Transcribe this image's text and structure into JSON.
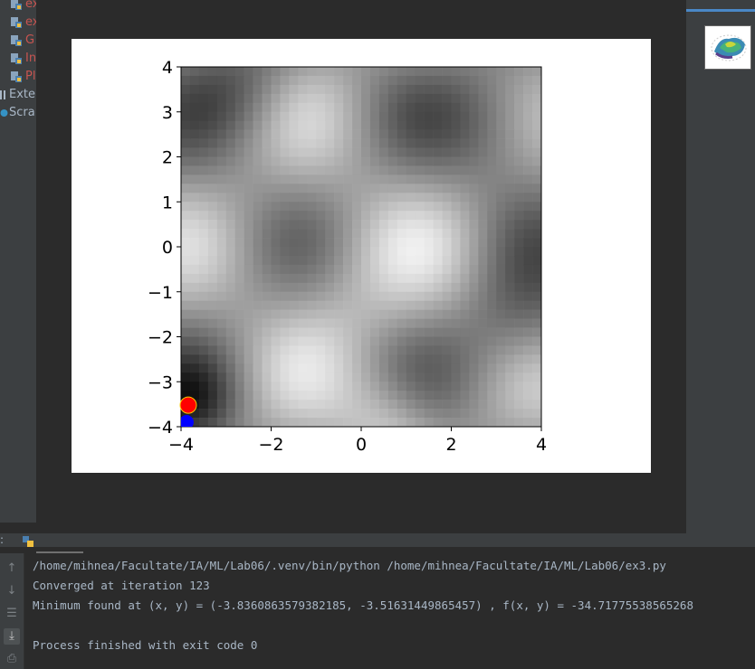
{
  "project_tree": {
    "items": [
      {
        "label": "ex",
        "kind": "python-file"
      },
      {
        "label": "ex",
        "kind": "python-file"
      },
      {
        "label": "G",
        "kind": "python-file"
      },
      {
        "label": "In",
        "kind": "python-file"
      },
      {
        "label": "Pl",
        "kind": "python-file"
      }
    ],
    "external_libraries": "Exte",
    "scratches": "Scra"
  },
  "plot_window": {
    "chart_data": {
      "type": "heatmap",
      "colormap": "gray",
      "x_range": [
        -4,
        4
      ],
      "y_range": [
        -4,
        4
      ],
      "x_ticks": [
        "−4",
        "−2",
        "0",
        "2",
        "4"
      ],
      "y_ticks": [
        "4",
        "3",
        "2",
        "1",
        "0",
        "−1",
        "−2",
        "−3",
        "−4"
      ],
      "markers": [
        {
          "name": "red point",
          "x": -3.84,
          "y": -3.52,
          "color": "#ff0000"
        },
        {
          "name": "blue point",
          "x": -3.88,
          "y": -3.9,
          "color": "#0000ff"
        }
      ]
    }
  },
  "console": {
    "lines": [
      "/home/mihnea/Facultate/IA/ML/Lab06/.venv/bin/python /home/mihnea/Facultate/IA/ML/Lab06/ex3.py",
      "Converged at iteration 123",
      "Minimum found at (x, y) = (-3.8360863579382185, -3.51631449865457) , f(x, y) = -34.71775538565268",
      "",
      "Process finished with exit code 0"
    ]
  },
  "run_toolbar": {
    "icons": [
      "up-arrow-icon",
      "down-arrow-icon",
      "soft-wrap-icon",
      "scroll-to-end-icon",
      "print-icon"
    ]
  }
}
